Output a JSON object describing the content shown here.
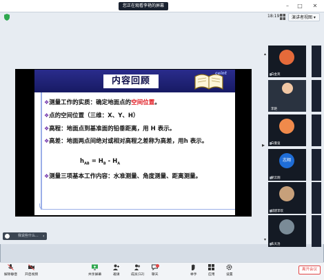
{
  "window": {
    "title": "您正在观看李艳的屏幕",
    "time": "18:19",
    "view_button": "演讲者视图"
  },
  "share": {
    "label": "",
    "strip": ""
  },
  "slide": {
    "title": "内容回顾",
    "brand": "ceint",
    "lines": [
      {
        "prefix": "测量工作的实质：确定地面点的",
        "highlight": "空间位置",
        "suffix": "。"
      },
      {
        "prefix": "点的空间位置（三维：X、Y、H）",
        "highlight": "",
        "suffix": ""
      },
      {
        "prefix": "高程：地面点到基准面的铅垂距离，用 H 表示。",
        "highlight": "",
        "suffix": ""
      },
      {
        "prefix": "高差：地面两点间绝对或相对高程之差称为高差，用",
        "highlight": "",
        "suffix": "h 表示。"
      },
      {
        "prefix": "测量三项基本工作内容：水准测量、角度测量、距离测量。",
        "highlight": "",
        "suffix": ""
      }
    ],
    "formula": {
      "left": "h",
      "left_sub": "AB",
      "eq": " = H",
      "h1_sub": "B",
      "minus": " - H",
      "h2_sub": "A"
    }
  },
  "chat_input": {
    "placeholder": "我说些什么..."
  },
  "participants": [
    {
      "name": "白金英",
      "color": "#e56a3a"
    },
    {
      "name": "李艳",
      "color": "#f1c7a4"
    },
    {
      "name": "白曼玺",
      "color": "#f08a4b"
    },
    {
      "name": "志翔",
      "color": "#1f6dd6"
    },
    {
      "name": "翟云翔",
      "color": "#6e7b88"
    },
    {
      "name": "城建李欢",
      "color": "#c7a07a"
    },
    {
      "name": "朱天洛",
      "color": "#7a8b97"
    }
  ],
  "toolbar": {
    "items": [
      {
        "label": "解除静音",
        "icon": "mic-muted-icon"
      },
      {
        "label": "开启视频",
        "icon": "camera-off-icon"
      },
      {
        "label": "共享屏幕",
        "icon": "share-screen-icon"
      },
      {
        "label": "邀请",
        "icon": "invite-icon"
      },
      {
        "label": "成员(12)",
        "icon": "members-icon"
      },
      {
        "label": "聊天",
        "icon": "chat-icon"
      },
      {
        "label": "举手",
        "icon": "raise-hand-icon"
      },
      {
        "label": "应用",
        "icon": "apps-icon"
      },
      {
        "label": "设置",
        "icon": "settings-icon"
      }
    ],
    "leave": "离开会议"
  },
  "colors": {
    "slide_header": "#1a1d6e",
    "highlight": "#e0141c",
    "leave": "#e24545"
  }
}
